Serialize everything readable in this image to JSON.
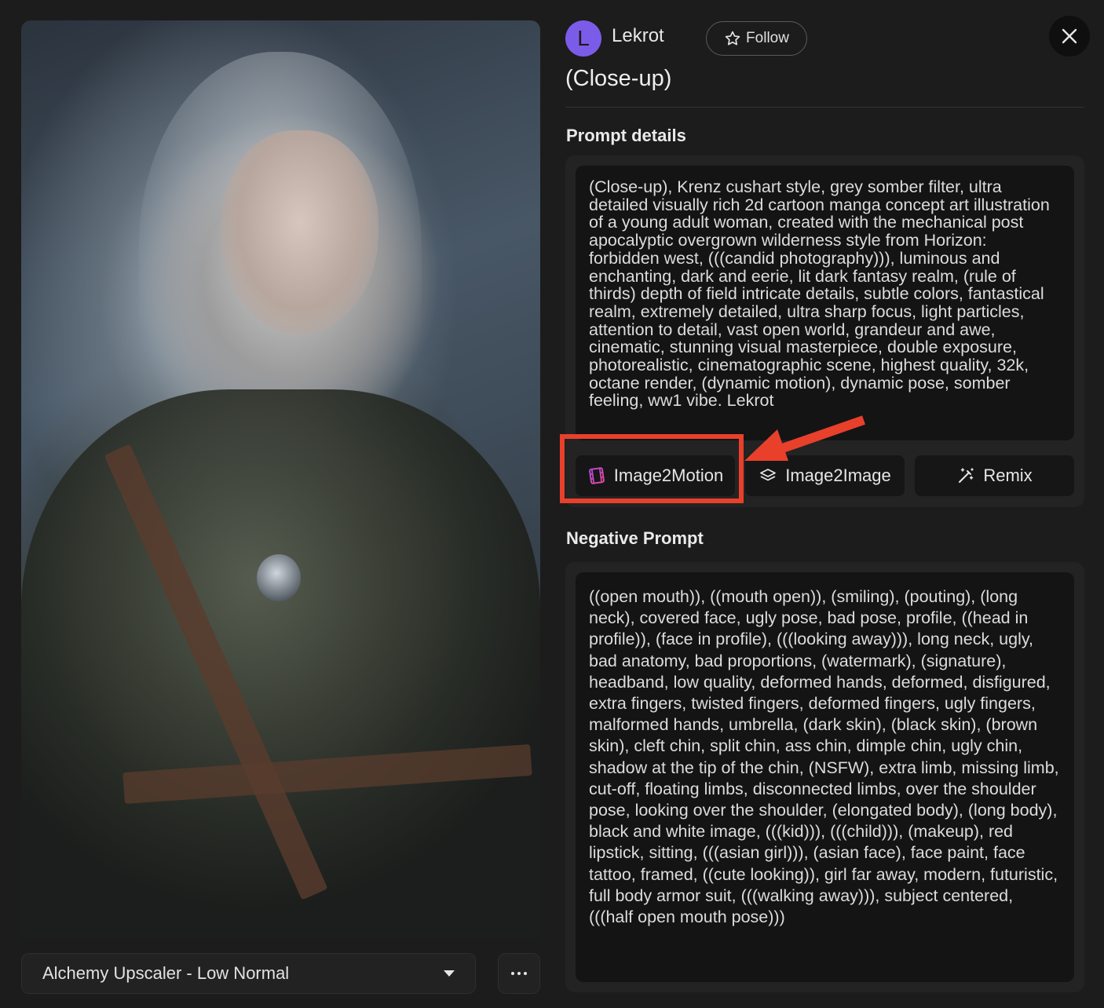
{
  "user": {
    "avatar_letter": "L",
    "name": "Lekrot",
    "follow_label": "Follow"
  },
  "title": "(Close-up)",
  "prompt_details": {
    "heading": "Prompt details",
    "text": "(Close-up), Krenz cushart style, grey somber filter, ultra detailed visually rich 2d cartoon manga concept art illustration of a young adult woman, created with the mechanical post apocalyptic overgrown wilderness style from Horizon: forbidden west, (((candid photography))), luminous and enchanting, dark and eerie, lit dark fantasy realm, (rule of thirds) depth of field intricate details, subtle colors, fantastical realm, extremely detailed, ultra sharp focus, light particles, attention to detail, vast open world, grandeur and awe, cinematic, stunning visual masterpiece, double exposure, photorealistic, cinematographic scene, highest quality, 32k, octane render, (dynamic motion), dynamic pose, somber feeling, ww1 vibe. Lekrot"
  },
  "actions": {
    "image2motion": "Image2Motion",
    "image2image": "Image2Image",
    "remix": "Remix"
  },
  "negative_prompt": {
    "heading": "Negative Prompt",
    "text": "((open mouth)), ((mouth open)), (smiling), (pouting), (long neck), covered face, ugly pose, bad pose, profile, ((head in profile)), (face in profile), (((looking away))), long neck, ugly, bad anatomy, bad proportions, (watermark), (signature), headband, low quality, deformed hands, deformed, disfigured, extra fingers, twisted fingers, deformed fingers, ugly fingers, malformed hands, umbrella, (dark skin), (black skin), (brown skin), cleft chin, split chin, ass chin, dimple chin, ugly chin, shadow at the tip of the chin, (NSFW), extra limb, missing limb, cut-off, floating limbs, disconnected limbs, over the shoulder pose, looking over the shoulder, (elongated body), (long body), black and white image, (((kid))), (((child))), (makeup), red lipstick, sitting, (((asian girl))), (asian face), face paint, face tattoo, framed, ((cute looking)), girl far away, modern, futuristic, full body armor suit, (((walking away))), subject centered, (((half open mouth pose)))"
  },
  "upscaler": {
    "selected": "Alchemy Upscaler - Low Normal"
  },
  "colors": {
    "accent_avatar": "#7b5ce9",
    "highlight": "#e8402b",
    "background": "#1c1c1c"
  },
  "icons": {
    "follow": "star-icon",
    "close": "close-icon",
    "image2motion": "film-icon",
    "image2image": "layers-icon",
    "remix": "magic-wand-icon",
    "upscaler": "caret-down-icon",
    "more": "more-icon"
  }
}
